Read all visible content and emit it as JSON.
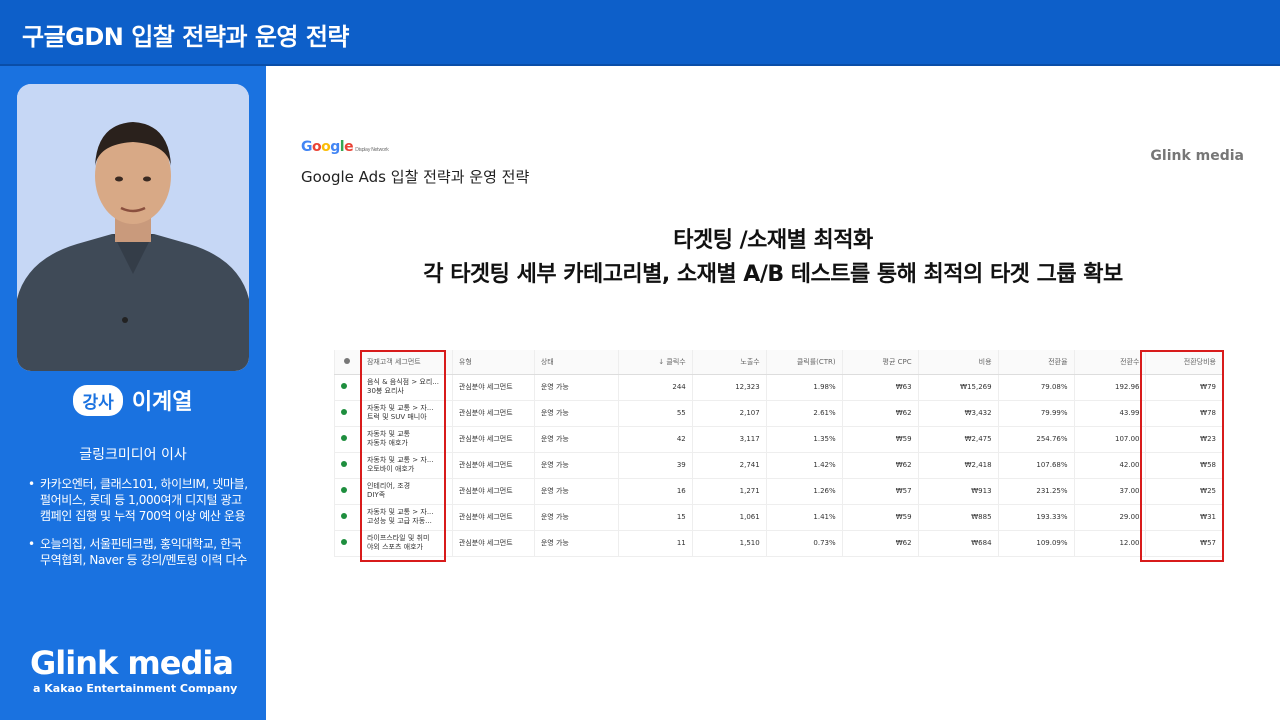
{
  "header": {
    "title": "구글GDN 입찰 전략과 운영 전략"
  },
  "sidebar": {
    "badge": "강사",
    "name": "이계열",
    "role": "글링크미디어 이사",
    "bullets": [
      "카카오엔터, 클래스101, 하이브IM, 넷마블, 펄어비스, 롯데 등 1,000여개 디지털 광고 캠페인 집행 및 누적 700억 이상 예산 운용",
      "오늘의집, 서울핀테크랩, 홍익대학교, 한국무역협회, Naver 등 강의/멘토링 이력 다수"
    ],
    "logo": "Glink media",
    "logo_sub": "a Kakao Entertainment Company"
  },
  "slide": {
    "google_logo": "Google",
    "google_logo_sub": "Display Network",
    "subtitle": "Google Ads 입찰 전략과 운영 전략",
    "watermark": "Glink media",
    "heading1": "타겟팅 /소재별 최적화",
    "heading2": "각 타겟팅 세부 카테고리별, 소재별 A/B 테스트를 통해 최적의 타겟 그룹 확보"
  },
  "table": {
    "headers": [
      "잠재고객 세그먼트",
      "유형",
      "상태",
      "↓ 클릭수",
      "노출수",
      "클릭률(CTR)",
      "평균 CPC",
      "비용",
      "전환율",
      "전환수",
      "전환당비용"
    ],
    "rows": [
      {
        "seg1": "음식 & 음식점 > 요리...",
        "seg2": "30봉 요리사",
        "type": "관심분야 세그먼트",
        "status": "운영 가능",
        "clicks": "244",
        "impr": "12,323",
        "ctr": "1.98%",
        "cpc": "₩63",
        "cost": "₩15,269",
        "cvr": "79.08%",
        "conv": "192.96",
        "cpa": "₩79"
      },
      {
        "seg1": "자동차 및 교통 > 자...",
        "seg2": "트럭 및 SUV 매니아",
        "type": "관심분야 세그먼트",
        "status": "운영 가능",
        "clicks": "55",
        "impr": "2,107",
        "ctr": "2.61%",
        "cpc": "₩62",
        "cost": "₩3,432",
        "cvr": "79.99%",
        "conv": "43.99",
        "cpa": "₩78"
      },
      {
        "seg1": "자동차 및 교통",
        "seg2": "자동차 애호가",
        "type": "관심분야 세그먼트",
        "status": "운영 가능",
        "clicks": "42",
        "impr": "3,117",
        "ctr": "1.35%",
        "cpc": "₩59",
        "cost": "₩2,475",
        "cvr": "254.76%",
        "conv": "107.00",
        "cpa": "₩23"
      },
      {
        "seg1": "자동차 및 교통 > 자...",
        "seg2": "오토바이 애호가",
        "type": "관심분야 세그먼트",
        "status": "운영 가능",
        "clicks": "39",
        "impr": "2,741",
        "ctr": "1.42%",
        "cpc": "₩62",
        "cost": "₩2,418",
        "cvr": "107.68%",
        "conv": "42.00",
        "cpa": "₩58"
      },
      {
        "seg1": "인테리어, 조경",
        "seg2": "DIY족",
        "type": "관심분야 세그먼트",
        "status": "운영 가능",
        "clicks": "16",
        "impr": "1,271",
        "ctr": "1.26%",
        "cpc": "₩57",
        "cost": "₩913",
        "cvr": "231.25%",
        "conv": "37.00",
        "cpa": "₩25"
      },
      {
        "seg1": "자동차 및 교통 > 자...",
        "seg2": "고성능 및 고급 자동...",
        "type": "관심분야 세그먼트",
        "status": "운영 가능",
        "clicks": "15",
        "impr": "1,061",
        "ctr": "1.41%",
        "cpc": "₩59",
        "cost": "₩885",
        "cvr": "193.33%",
        "conv": "29.00",
        "cpa": "₩31"
      },
      {
        "seg1": "라이프스타일 및 취미",
        "seg2": "야외 스포츠 애호가",
        "type": "관심분야 세그먼트",
        "status": "운영 가능",
        "clicks": "11",
        "impr": "1,510",
        "ctr": "0.73%",
        "cpc": "₩62",
        "cost": "₩684",
        "cvr": "109.09%",
        "conv": "12.00",
        "cpa": "₩57"
      }
    ]
  },
  "colors": {
    "brand_blue": "#1a72e0",
    "topbar_blue": "#0d5fc9",
    "highlight_red": "#d81b1b",
    "status_green": "#1e8e3e"
  }
}
